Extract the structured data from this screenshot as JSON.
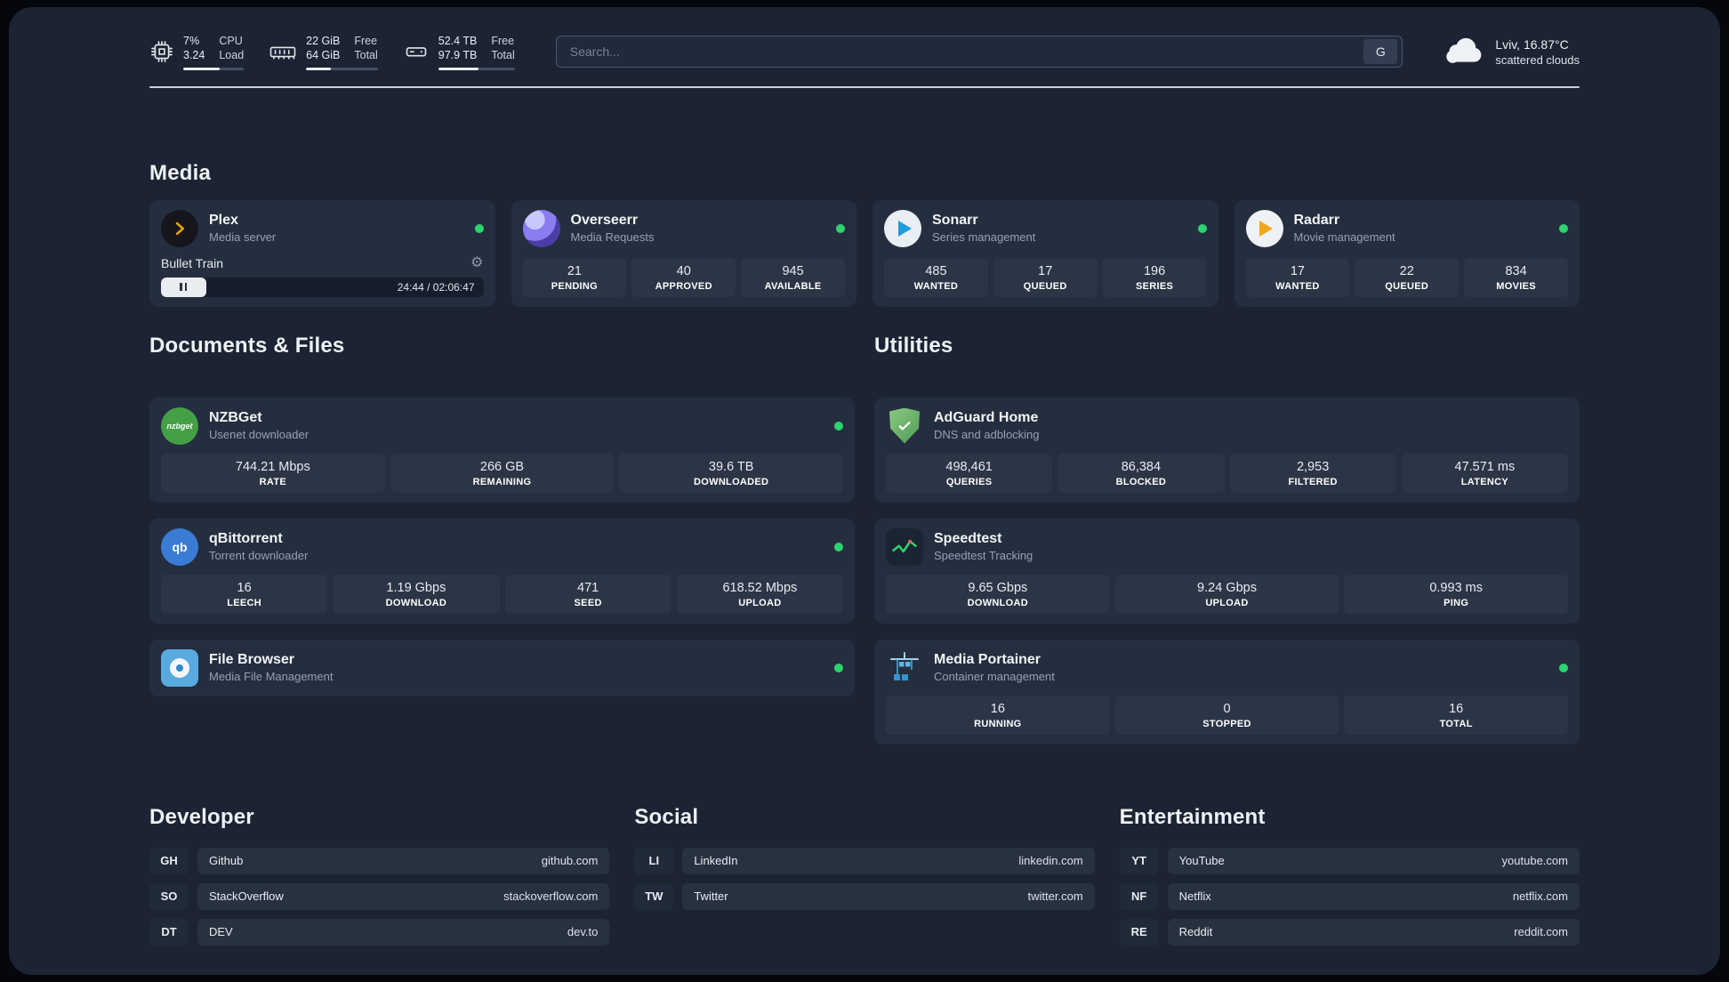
{
  "topbar": {
    "cpu": {
      "value_top": "7%",
      "value_bottom": "3.24",
      "label_top": "CPU",
      "label_bottom": "Load",
      "percent": 60
    },
    "memory": {
      "value_top": "22 GiB",
      "value_bottom": "64 GiB",
      "label_top": "Free",
      "label_bottom": "Total",
      "percent": 34
    },
    "storage": {
      "value_top": "52.4 TB",
      "value_bottom": "97.9 TB",
      "label_top": "Free",
      "label_bottom": "Total",
      "percent": 53
    },
    "search": {
      "placeholder": "Search...",
      "engine_button": "G"
    },
    "weather": {
      "location": "Lviv, 16.87°C",
      "condition": "scattered clouds"
    }
  },
  "media": {
    "section_title": "Media",
    "plex": {
      "name": "Plex",
      "subtitle": "Media server",
      "status": "online",
      "now_playing": "Bullet Train",
      "time": "24:44 / 02:06:47",
      "progress_percent": 14
    },
    "overseerr": {
      "name": "Overseerr",
      "subtitle": "Media Requests",
      "status": "online",
      "stats": [
        {
          "value": "21",
          "label": "PENDING"
        },
        {
          "value": "40",
          "label": "APPROVED"
        },
        {
          "value": "945",
          "label": "AVAILABLE"
        }
      ]
    },
    "sonarr": {
      "name": "Sonarr",
      "subtitle": "Series management",
      "status": "online",
      "stats": [
        {
          "value": "485",
          "label": "WANTED"
        },
        {
          "value": "17",
          "label": "QUEUED"
        },
        {
          "value": "196",
          "label": "SERIES"
        }
      ]
    },
    "radarr": {
      "name": "Radarr",
      "subtitle": "Movie management",
      "status": "online",
      "stats": [
        {
          "value": "17",
          "label": "WANTED"
        },
        {
          "value": "22",
          "label": "QUEUED"
        },
        {
          "value": "834",
          "label": "MOVIES"
        }
      ]
    }
  },
  "documents": {
    "section_title": "Documents & Files",
    "nzbget": {
      "name": "NZBGet",
      "subtitle": "Usenet downloader",
      "status": "online",
      "icon_text": "nzbget",
      "stats": [
        {
          "value": "744.21 Mbps",
          "label": "RATE"
        },
        {
          "value": "266 GB",
          "label": "REMAINING"
        },
        {
          "value": "39.6 TB",
          "label": "DOWNLOADED"
        }
      ]
    },
    "qbittorrent": {
      "name": "qBittorrent",
      "subtitle": "Torrent downloader",
      "status": "online",
      "icon_text": "qb",
      "stats": [
        {
          "value": "16",
          "label": "LEECH"
        },
        {
          "value": "1.19 Gbps",
          "label": "DOWNLOAD"
        },
        {
          "value": "471",
          "label": "SEED"
        },
        {
          "value": "618.52 Mbps",
          "label": "UPLOAD"
        }
      ]
    },
    "filebrowser": {
      "name": "File Browser",
      "subtitle": "Media File Management",
      "status": "online"
    }
  },
  "utilities": {
    "section_title": "Utilities",
    "adguard": {
      "name": "AdGuard Home",
      "subtitle": "DNS and adblocking",
      "stats": [
        {
          "value": "498,461",
          "label": "QUERIES"
        },
        {
          "value": "86,384",
          "label": "BLOCKED"
        },
        {
          "value": "2,953",
          "label": "FILTERED"
        },
        {
          "value": "47.571 ms",
          "label": "LATENCY"
        }
      ]
    },
    "speedtest": {
      "name": "Speedtest",
      "subtitle": "Speedtest Tracking",
      "stats": [
        {
          "value": "9.65 Gbps",
          "label": "DOWNLOAD"
        },
        {
          "value": "9.24 Gbps",
          "label": "UPLOAD"
        },
        {
          "value": "0.993 ms",
          "label": "PING"
        }
      ]
    },
    "portainer": {
      "name": "Media Portainer",
      "subtitle": "Container management",
      "status": "online",
      "stats": [
        {
          "value": "16",
          "label": "RUNNING"
        },
        {
          "value": "0",
          "label": "STOPPED"
        },
        {
          "value": "16",
          "label": "TOTAL"
        }
      ]
    }
  },
  "bookmarks": {
    "developer": {
      "section_title": "Developer",
      "items": [
        {
          "abbr": "GH",
          "name": "Github",
          "url": "github.com"
        },
        {
          "abbr": "SO",
          "name": "StackOverflow",
          "url": "stackoverflow.com"
        },
        {
          "abbr": "DT",
          "name": "DEV",
          "url": "dev.to"
        }
      ]
    },
    "social": {
      "section_title": "Social",
      "items": [
        {
          "abbr": "LI",
          "name": "LinkedIn",
          "url": "linkedin.com"
        },
        {
          "abbr": "TW",
          "name": "Twitter",
          "url": "twitter.com"
        }
      ]
    },
    "entertainment": {
      "section_title": "Entertainment",
      "items": [
        {
          "abbr": "YT",
          "name": "YouTube",
          "url": "youtube.com"
        },
        {
          "abbr": "NF",
          "name": "Netflix",
          "url": "netflix.com"
        },
        {
          "abbr": "RE",
          "name": "Reddit",
          "url": "reddit.com"
        }
      ]
    }
  },
  "glyphs": {
    "gear": "⚙"
  },
  "colors": {
    "background": "#1c2433",
    "card": "#252e3e",
    "stat_box": "#2c3546",
    "status_online": "#2dd36f",
    "plex_amber": "#e5a00d"
  }
}
